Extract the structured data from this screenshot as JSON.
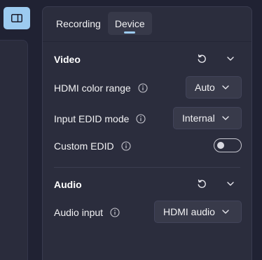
{
  "tabs": [
    {
      "label": "Recording",
      "active": false
    },
    {
      "label": "Device",
      "active": true
    }
  ],
  "video": {
    "title": "Video",
    "rows": {
      "hdmi_color_range": {
        "label": "HDMI color range",
        "value": "Auto"
      },
      "input_edid_mode": {
        "label": "Input EDID mode",
        "value": "Internal"
      },
      "custom_edid": {
        "label": "Custom EDID",
        "enabled": false
      }
    }
  },
  "audio": {
    "title": "Audio",
    "rows": {
      "audio_input": {
        "label": "Audio input",
        "value": "HDMI audio"
      }
    }
  },
  "colors": {
    "accent": "#9ccbf0",
    "background": "#202233",
    "panel": "#2b2d3d",
    "control": "#383a4a"
  },
  "icons": {
    "sidebar_toggle": "panel-left-icon",
    "reset": "reset-icon",
    "collapse": "chevron-down-icon",
    "info": "info-icon"
  }
}
